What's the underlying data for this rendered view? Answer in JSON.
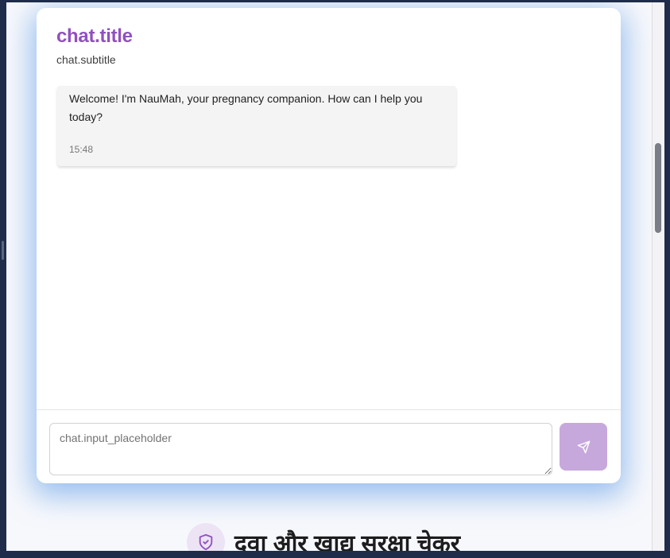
{
  "chat": {
    "title": "chat.title",
    "subtitle": "chat.subtitle",
    "messages": [
      {
        "sender": "assistant",
        "text": "Welcome! I'm NauMah, your pregnancy companion. How can I help you today?",
        "time": "15:48"
      }
    ],
    "input_value": "",
    "input_placeholder": "chat.input_placeholder",
    "send_icon": "send-icon"
  },
  "safety_section": {
    "icon": "shield-check-icon",
    "title": "दवा और खाद्य सुरक्षा चेकर"
  },
  "colors": {
    "accent": "#9150c0",
    "send_button": "#c7a8dd",
    "card_glow": "#4a90e2",
    "bubble_bg": "#f4f4f4",
    "window_bg": "#1f2d4a",
    "page_bg": "#f7f8fc"
  }
}
